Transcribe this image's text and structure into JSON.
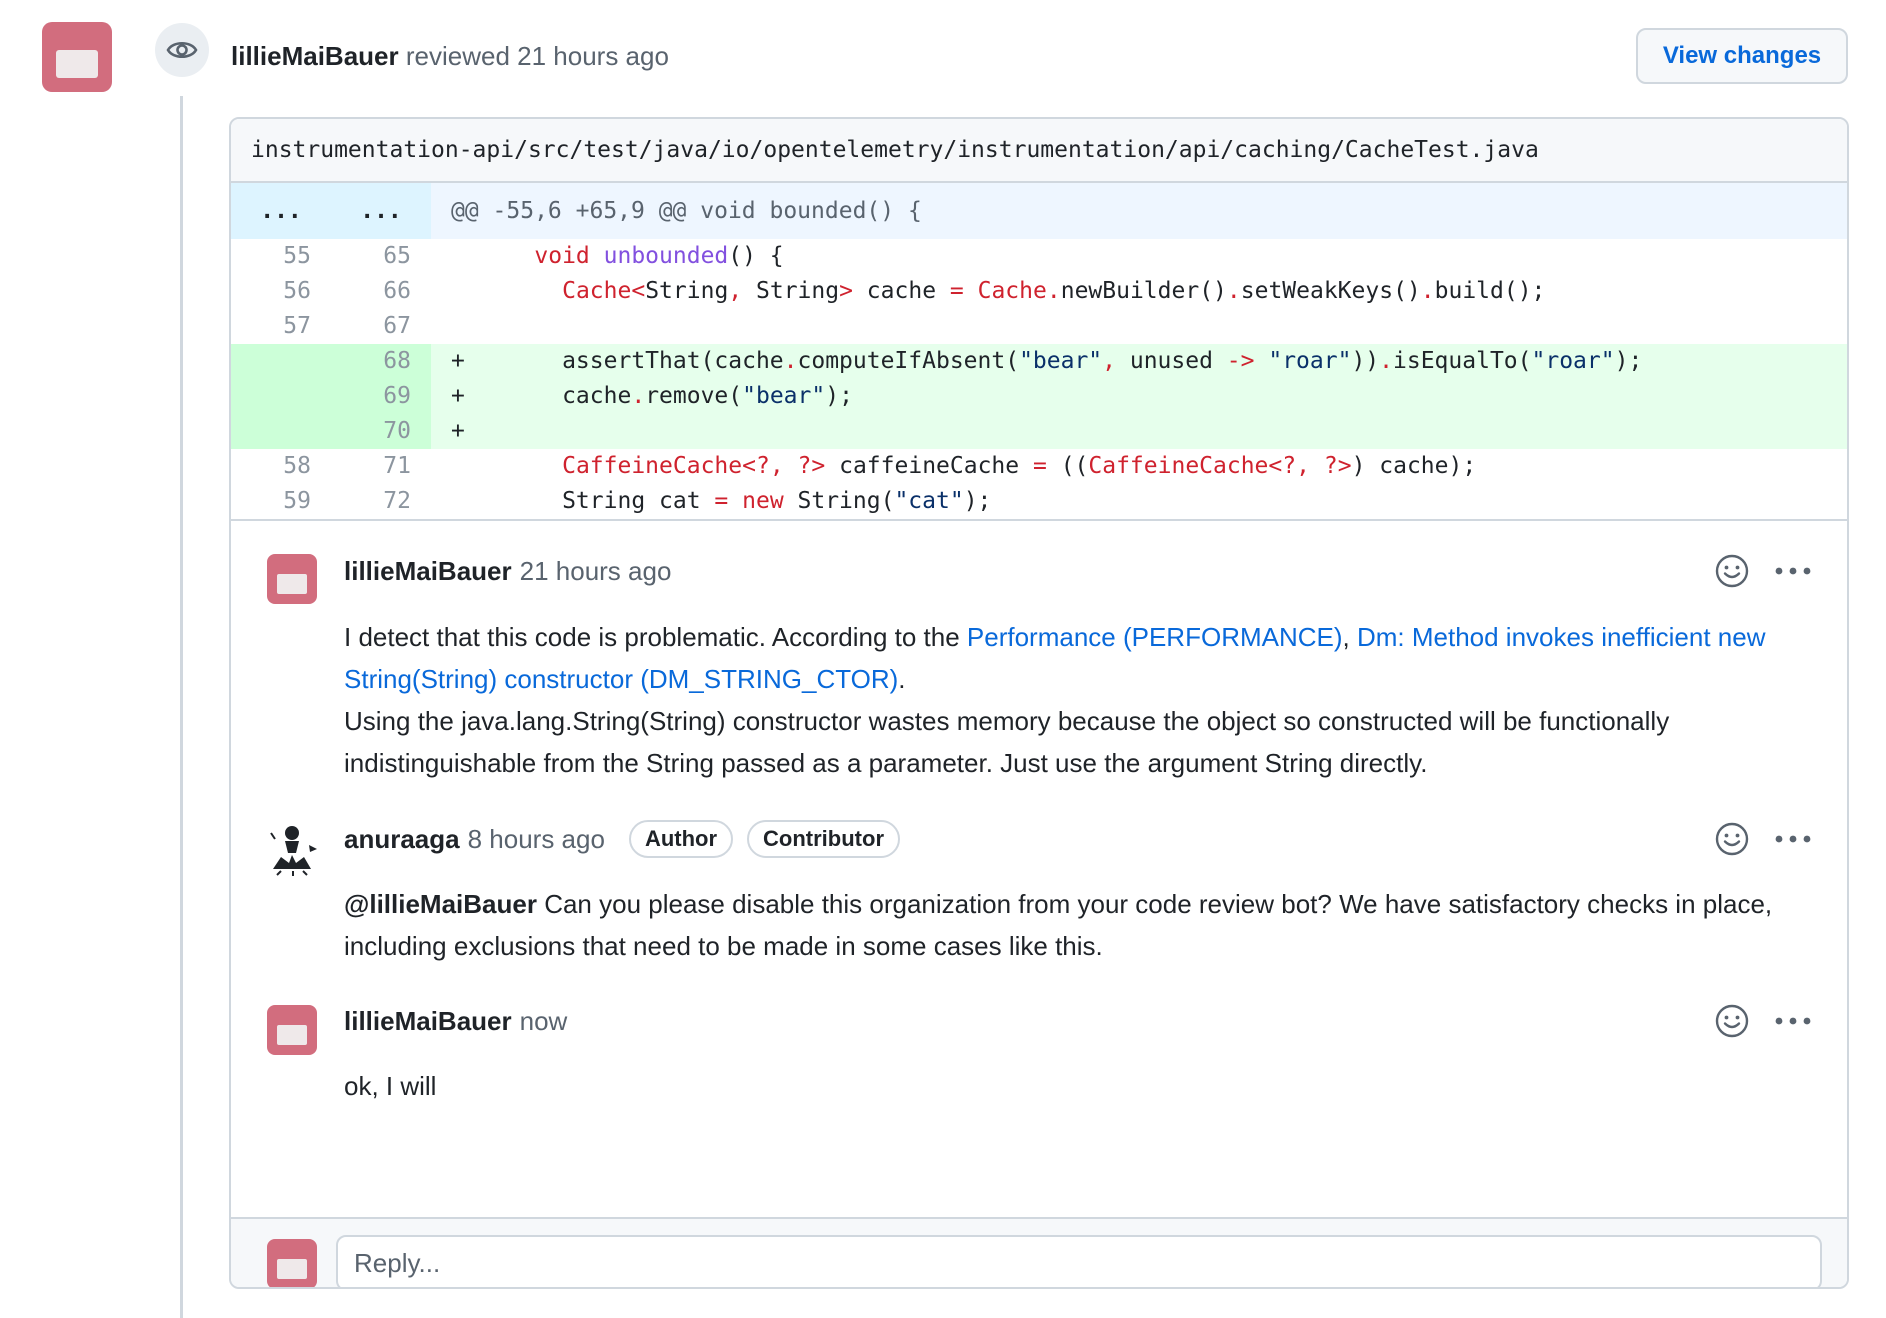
{
  "review": {
    "user": "lillieMaiBauer",
    "action": "reviewed",
    "time": "21 hours ago",
    "view_changes_label": "View changes"
  },
  "file": {
    "path": "instrumentation-api/src/test/java/io/opentelemetry/instrumentation/api/caching/CacheTest.java"
  },
  "diff": {
    "hunk_left": "...",
    "hunk_right": "...",
    "hunk_header": "@@ -55,6 +65,9 @@ void bounded() {",
    "lines": [
      {
        "old": "55",
        "new": "65",
        "sign": "",
        "type": "context",
        "code": "    void unbounded() {"
      },
      {
        "old": "56",
        "new": "66",
        "sign": "",
        "type": "context",
        "code": "      Cache<String, String> cache = Cache.newBuilder().setWeakKeys().build();"
      },
      {
        "old": "57",
        "new": "67",
        "sign": "",
        "type": "context",
        "code": ""
      },
      {
        "old": "",
        "new": "68",
        "sign": "+",
        "type": "add",
        "code": "      assertThat(cache.computeIfAbsent(\"bear\", unused -> \"roar\")).isEqualTo(\"roar\");"
      },
      {
        "old": "",
        "new": "69",
        "sign": "+",
        "type": "add",
        "code": "      cache.remove(\"bear\");"
      },
      {
        "old": "",
        "new": "70",
        "sign": "+",
        "type": "add",
        "code": ""
      },
      {
        "old": "58",
        "new": "71",
        "sign": "",
        "type": "context",
        "code": "      CaffeineCache<?, ?> caffeineCache = ((CaffeineCache<?, ?>) cache);"
      },
      {
        "old": "59",
        "new": "72",
        "sign": "",
        "type": "context",
        "code": "      String cat = new String(\"cat\");"
      }
    ]
  },
  "comments": [
    {
      "user": "lillieMaiBauer",
      "time": "21 hours ago",
      "body_prefix": "I detect that this code is problematic. According to the ",
      "link1": "Performance (PERFORMANCE)",
      "sep": ", ",
      "link2": "Dm: Method invokes inefficient new String(String) constructor (DM_STRING_CTOR)",
      "body_dot": ".",
      "body_rest": "Using the java.lang.String(String) constructor wastes memory because the object so constructed will be functionally indistinguishable from the String passed as a parameter.  Just use the argument String directly."
    },
    {
      "user": "anuraaga",
      "time": "8 hours ago",
      "badge1": "Author",
      "badge2": "Contributor",
      "mention": "@lillieMaiBauer",
      "body": " Can you please disable this organization from your code review bot? We have satisfactory checks in place, including exclusions that need to be made in some cases like this."
    },
    {
      "user": "lillieMaiBauer",
      "time": "now",
      "body": "ok, I will"
    }
  ],
  "reply": {
    "placeholder": "Reply..."
  },
  "colors": {
    "accent": "#0969da",
    "avatar": "#d26d7e",
    "add_bg": "#e6ffec",
    "hunk_bg": "#ddf4ff"
  }
}
